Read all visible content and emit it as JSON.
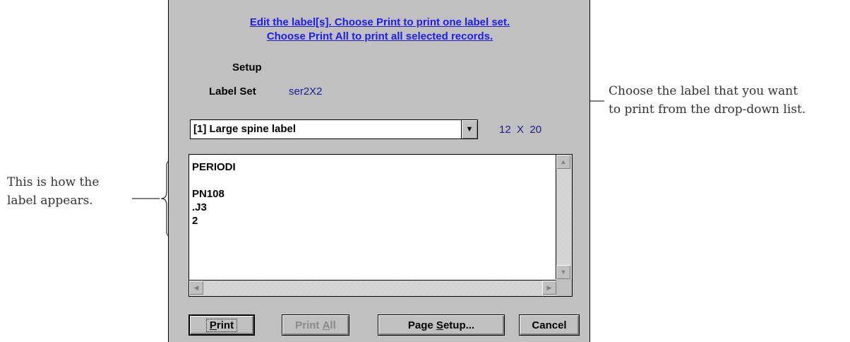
{
  "dialog": {
    "instructions": [
      "Edit the label[s]. Choose Print to print one label set.",
      "Choose Print All to print all selected records."
    ],
    "setup_label": "Setup",
    "label_set_label": "Label Set",
    "label_set_value": "ser2X2",
    "label_dropdown": {
      "selected": "[1] Large spine label"
    },
    "label_size": "12  X  20",
    "label_content": "PERIODI\n\nPN108\n.J3\n2",
    "buttons": {
      "print": {
        "pre": "",
        "underline": "P",
        "post": "rint"
      },
      "print_all": {
        "pre": "Print ",
        "underline": "A",
        "post": "ll"
      },
      "page_setup": {
        "pre": "Page ",
        "underline": "S",
        "post": "etup..."
      },
      "cancel": "Cancel"
    }
  },
  "annotations": {
    "right": [
      "Choose the label that you want",
      "to print from the drop-down list."
    ],
    "left": [
      "This is how the",
      "label appears."
    ]
  },
  "icons": {
    "dropdown_arrow": "chevron-down-icon",
    "scroll_up": "arrow-up-icon",
    "scroll_down": "arrow-down-icon",
    "scroll_left": "arrow-left-icon",
    "scroll_right": "arrow-right-icon"
  }
}
